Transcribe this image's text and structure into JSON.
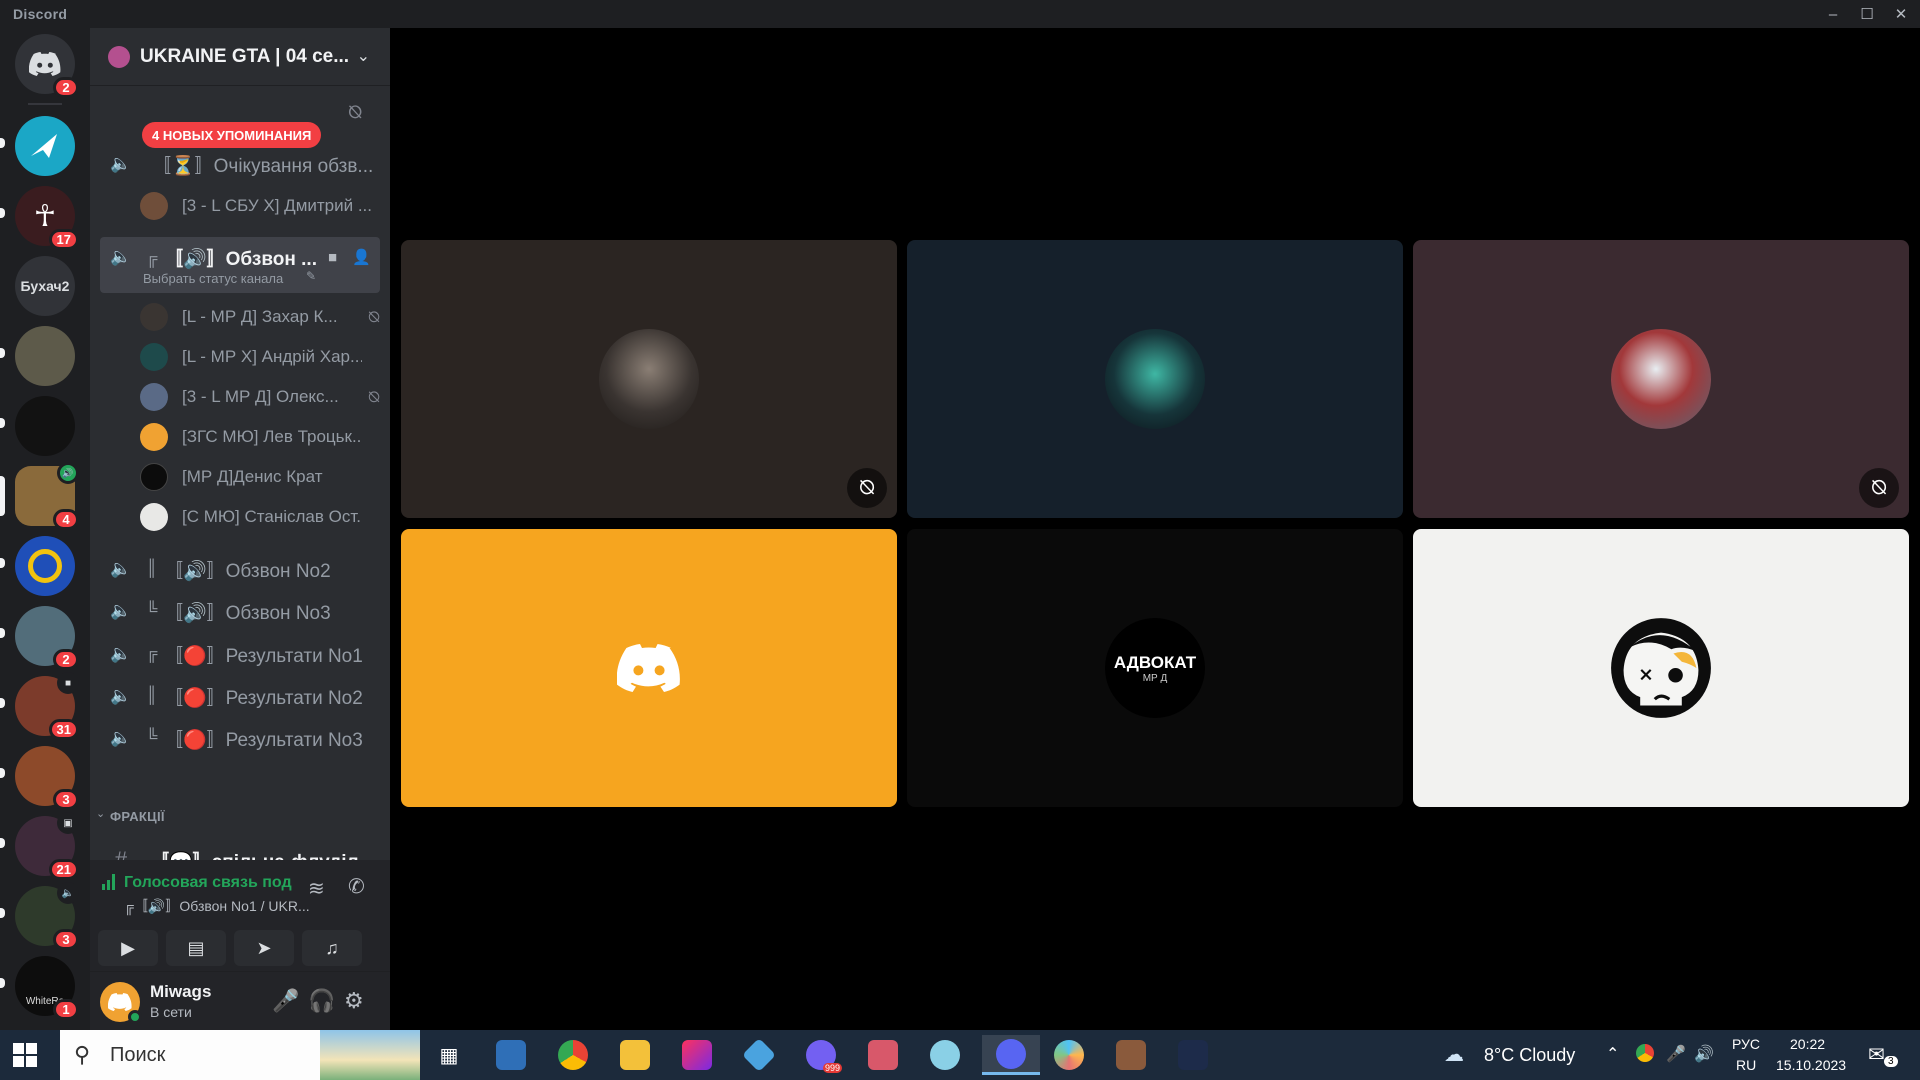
{
  "window": {
    "app_title": "Discord",
    "controls": [
      "minimize",
      "maximize",
      "close"
    ]
  },
  "server_rail": {
    "home_badge": "2",
    "servers": [
      {
        "name": "server-1",
        "badge": ""
      },
      {
        "name": "server-2",
        "badge": "17"
      },
      {
        "name": "Бухач2",
        "label": "Бухач2",
        "badge": ""
      },
      {
        "name": "server-4",
        "badge": ""
      },
      {
        "name": "server-5",
        "badge": ""
      },
      {
        "name": "server-6",
        "badge": "4"
      },
      {
        "name": "server-7",
        "badge": ""
      },
      {
        "name": "server-8",
        "badge": "2"
      },
      {
        "name": "server-9",
        "badge": "31"
      },
      {
        "name": "server-10",
        "badge": "3"
      },
      {
        "name": "server-11",
        "badge": "21"
      },
      {
        "name": "server-12",
        "badge": "3"
      },
      {
        "name": "server-13",
        "label": "WhiteRa",
        "badge": "1"
      }
    ]
  },
  "sidebar": {
    "server_name": "UKRAINE GTA | 04 се...",
    "mentions_pill": "4 НОВЫХ УПОМИНАНИЯ",
    "channels": [
      {
        "label": "〚⏳〛Очікування обзв...",
        "type": "voice"
      },
      {
        "label": "〚🔊〛Обзвон ...",
        "type": "voice-active",
        "prefix": "╔",
        "status_hint": "Выбрать статус канала"
      },
      {
        "label": "〚🔊〛Обзвон No2",
        "type": "voice",
        "prefix": "║"
      },
      {
        "label": "〚🔊〛Обзвон No3",
        "type": "voice",
        "prefix": "╚"
      },
      {
        "label": "〚🔴〛Результати No1",
        "type": "voice",
        "prefix": "╔"
      },
      {
        "label": "〚🔴〛Результати No2",
        "type": "voice",
        "prefix": "║"
      },
      {
        "label": "〚🔴〛Результати No3",
        "type": "voice",
        "prefix": "╚"
      }
    ],
    "waiting_member": "[3 - L СБУ Х] Дмитрий ...",
    "members": [
      {
        "name": "[L - МР Д] Захар К...",
        "muted": true
      },
      {
        "name": "[L - МР Х] Андрій Хар...",
        "muted": false
      },
      {
        "name": "[3 - L МР Д] Олекс...",
        "muted": true
      },
      {
        "name": "[ЗГС МЮ] Лев Троцьк...",
        "muted": false
      },
      {
        "name": "[МР Д]Денис Крат",
        "muted": false
      },
      {
        "name": "[С МЮ] Станіслав Ост...",
        "muted": false
      }
    ],
    "category": "ФРАКЦІЇ",
    "text_channel": "〚💬〛спільна-флуділ..."
  },
  "voice_panel": {
    "status": "Голосовая связь под",
    "channel": "╔〚🔊〛Обзвон No1 / UKR...",
    "buttons": [
      "camera",
      "screen-share",
      "activity",
      "soundboard"
    ]
  },
  "user_panel": {
    "username": "Miwags",
    "status": "В сети"
  },
  "video_tiles": [
    {
      "name": "tile-1",
      "bg": "#2b2522",
      "muted": true
    },
    {
      "name": "tile-2",
      "bg": "#15202b",
      "muted": false
    },
    {
      "name": "tile-3",
      "bg": "#3b2a30",
      "muted": true
    },
    {
      "name": "tile-4",
      "bg": "#f6a51f",
      "muted": false
    },
    {
      "name": "tile-5",
      "bg": "#0a0a0a",
      "muted": false,
      "avatar_text": "АДВОКАТ",
      "avatar_sub": "МР Д"
    },
    {
      "name": "tile-6",
      "bg": "#f2f2f0",
      "muted": false
    }
  ],
  "taskbar": {
    "search_placeholder": "Поиск",
    "weather": "8°C  Cloudy",
    "lang_top": "РУС",
    "lang_bottom": "RU",
    "time": "20:22",
    "date": "15.10.2023",
    "notifications": "3",
    "viber_badge": "999"
  }
}
